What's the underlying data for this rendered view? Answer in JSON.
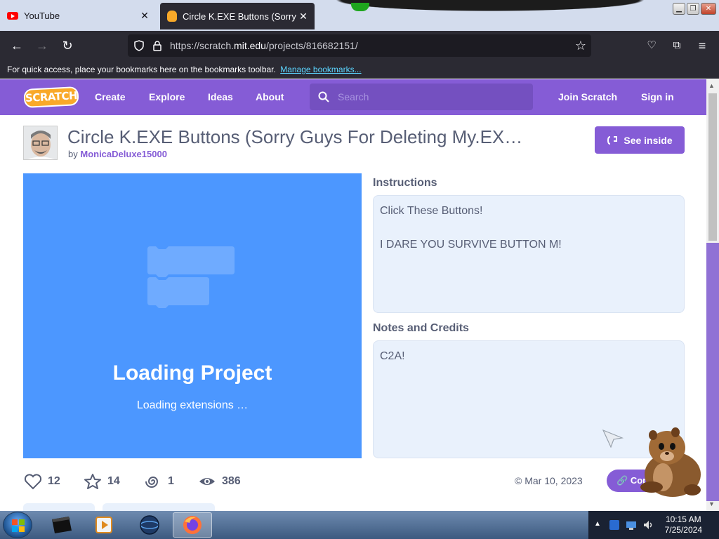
{
  "browser": {
    "tabs": [
      {
        "title": "YouTube",
        "active": false
      },
      {
        "title": "Circle K.EXE Buttons (Sorry Guys",
        "active": true
      }
    ],
    "url_prefix": "https://scratch.",
    "url_domain": "mit.edu",
    "url_path": "/projects/816682151/",
    "bookmarks_text": "For quick access, place your bookmarks here on the bookmarks toolbar.",
    "bookmarks_link": "Manage bookmarks..."
  },
  "scratch_header": {
    "logo": "SCRATCH",
    "nav": [
      "Create",
      "Explore",
      "Ideas",
      "About"
    ],
    "search_placeholder": "Search",
    "join": "Join Scratch",
    "signin": "Sign in",
    "accent": "#855cd6"
  },
  "project": {
    "title": "Circle K.EXE Buttons (Sorry Guys For Deleting My.EX…",
    "by_label": "by",
    "author": "MonicaDeluxe15000",
    "see_inside": "See inside",
    "loading_title": "Loading Project",
    "loading_sub": "Loading extensions …",
    "instructions_label": "Instructions",
    "instructions": "Click These Buttons!\n\nI DARE YOU SURVIVE BUTTON M!",
    "notes_label": "Notes and Credits",
    "notes": "C2A!",
    "stats": {
      "loves": "12",
      "favorites": "14",
      "remixes": "1",
      "views": "386"
    },
    "date": "Mar 10, 2023",
    "copy_link": "Copy Link"
  },
  "taskbar": {
    "time": "10:15 AM",
    "date": "7/25/2024"
  }
}
